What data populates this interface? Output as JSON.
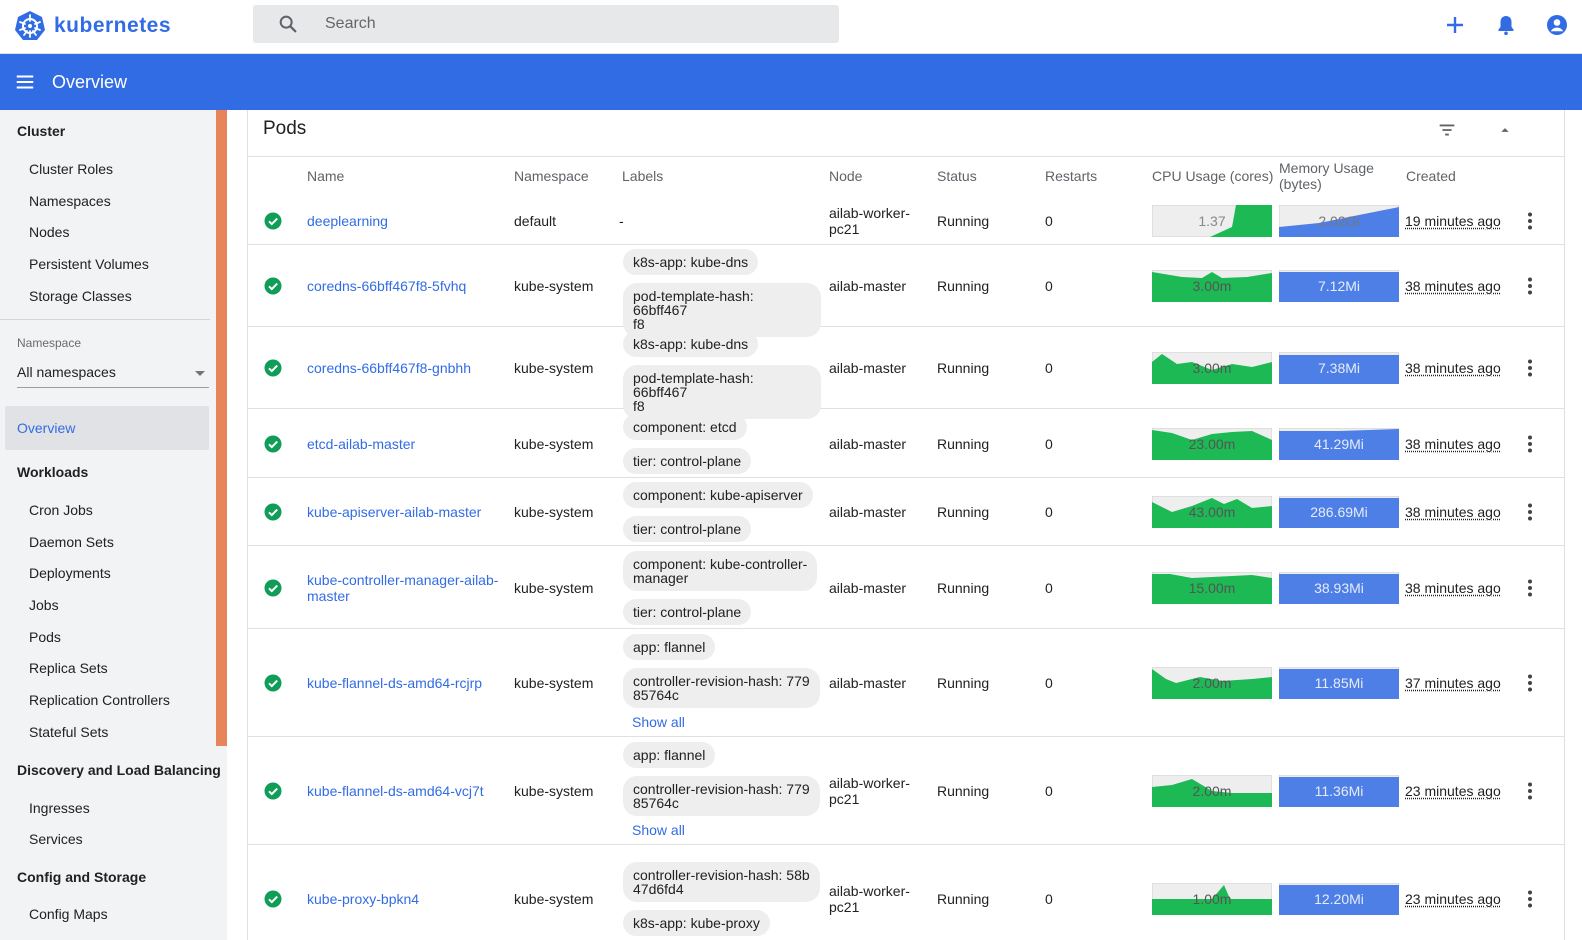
{
  "app": {
    "name": "kubernetes"
  },
  "search": {
    "placeholder": "Search"
  },
  "toolbar": {
    "title": "Overview"
  },
  "sidebar": {
    "cluster_heading": "Cluster",
    "cluster_items": [
      "Cluster Roles",
      "Namespaces",
      "Nodes",
      "Persistent Volumes",
      "Storage Classes"
    ],
    "namespace_label": "Namespace",
    "namespace_value": "All namespaces",
    "active_item": "Overview",
    "workloads_heading": "Workloads",
    "workload_items": [
      "Cron Jobs",
      "Daemon Sets",
      "Deployments",
      "Jobs",
      "Pods",
      "Replica Sets",
      "Replication Controllers",
      "Stateful Sets"
    ],
    "discovery_heading": "Discovery and Load Balancing",
    "discovery_items": [
      "Ingresses",
      "Services"
    ],
    "config_heading": "Config and Storage",
    "config_items": [
      "Config Maps"
    ]
  },
  "pods": {
    "title": "Pods",
    "columns": {
      "name": "Name",
      "namespace": "Namespace",
      "labels": "Labels",
      "node": "Node",
      "status": "Status",
      "restarts": "Restarts",
      "cpu": "CPU Usage (cores)",
      "memory_line1": "Memory Usage",
      "memory_line2": "(bytes)",
      "created": "Created"
    },
    "rows": [
      {
        "name": "deeplearning",
        "namespace": "default",
        "labels_text": "-",
        "labels": [],
        "show_all": "",
        "node": [
          "ailab-worker-",
          "pc21"
        ],
        "status": "Running",
        "restarts": "0",
        "cpu": "1.37",
        "memory": "2.02Gi",
        "created": "19 minutes ago"
      },
      {
        "name": "coredns-66bff467f8-5fvhq",
        "namespace": "kube-system",
        "labels_text": "",
        "labels": [
          "k8s-app: kube-dns",
          "pod-template-hash: 66bff467\nf8"
        ],
        "show_all": "",
        "node": [
          "ailab-master"
        ],
        "status": "Running",
        "restarts": "0",
        "cpu": "3.00m",
        "memory": "7.12Mi",
        "created": "38 minutes ago"
      },
      {
        "name": "coredns-66bff467f8-gnbhh",
        "namespace": "kube-system",
        "labels_text": "",
        "labels": [
          "k8s-app: kube-dns",
          "pod-template-hash: 66bff467\nf8"
        ],
        "show_all": "",
        "node": [
          "ailab-master"
        ],
        "status": "Running",
        "restarts": "0",
        "cpu": "3.00m",
        "memory": "7.38Mi",
        "created": "38 minutes ago"
      },
      {
        "name": "etcd-ailab-master",
        "namespace": "kube-system",
        "labels_text": "",
        "labels": [
          "component: etcd",
          "tier: control-plane"
        ],
        "show_all": "",
        "node": [
          "ailab-master"
        ],
        "status": "Running",
        "restarts": "0",
        "cpu": "23.00m",
        "memory": "41.29Mi",
        "created": "38 minutes ago"
      },
      {
        "name": "kube-apiserver-ailab-master",
        "namespace": "kube-system",
        "labels_text": "",
        "labels": [
          "component: kube-apiserver",
          "tier: control-plane"
        ],
        "show_all": "",
        "node": [
          "ailab-master"
        ],
        "status": "Running",
        "restarts": "0",
        "cpu": "43.00m",
        "memory": "286.69Mi",
        "created": "38 minutes ago"
      },
      {
        "name": "kube-controller-manager-ailab-\nmaster",
        "namespace": "kube-system",
        "labels_text": "",
        "labels": [
          "component: kube-controller-\nmanager",
          "tier: control-plane"
        ],
        "show_all": "",
        "node": [
          "ailab-master"
        ],
        "status": "Running",
        "restarts": "0",
        "cpu": "15.00m",
        "memory": "38.93Mi",
        "created": "38 minutes ago"
      },
      {
        "name": "kube-flannel-ds-amd64-rcjrp",
        "namespace": "kube-system",
        "labels_text": "",
        "labels": [
          "app: flannel",
          "controller-revision-hash: 779\n85764c"
        ],
        "show_all": "Show all",
        "node": [
          "ailab-master"
        ],
        "status": "Running",
        "restarts": "0",
        "cpu": "2.00m",
        "memory": "11.85Mi",
        "created": "37 minutes ago"
      },
      {
        "name": "kube-flannel-ds-amd64-vcj7t",
        "namespace": "kube-system",
        "labels_text": "",
        "labels": [
          "app: flannel",
          "controller-revision-hash: 779\n85764c"
        ],
        "show_all": "Show all",
        "node": [
          "ailab-worker-",
          "pc21"
        ],
        "status": "Running",
        "restarts": "0",
        "cpu": "2.00m",
        "memory": "11.36Mi",
        "created": "23 minutes ago"
      },
      {
        "name": "kube-proxy-bpkn4",
        "namespace": "kube-system",
        "labels_text": "",
        "labels": [
          "controller-revision-hash: 58b\n47d6fd4",
          "k8s-app: kube-proxy"
        ],
        "show_all": "",
        "node": [
          "ailab-worker-",
          "pc21"
        ],
        "status": "Running",
        "restarts": "0",
        "cpu": "1.00m",
        "memory": "12.20Mi",
        "created": "23 minutes ago"
      }
    ]
  },
  "colors": {
    "brand": "#326ce5",
    "ok": "#0f9d58",
    "cpu_fill": "#1db954",
    "memory_fill": "#4d7fe6",
    "spark_bg": "#eeeeee"
  },
  "icons": [
    "kubernetes-logo-icon",
    "search-icon",
    "add-icon",
    "bell-icon",
    "account-icon",
    "menu-icon",
    "filter-icon",
    "collapse-icon",
    "check-circle-icon",
    "more-vert-icon"
  ]
}
